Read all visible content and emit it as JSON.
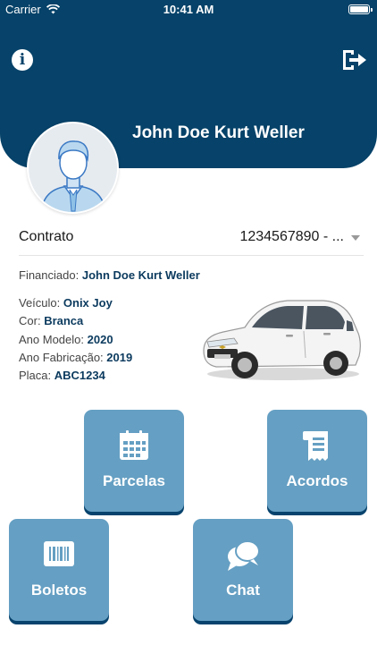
{
  "status_bar": {
    "carrier": "Carrier",
    "time": "10:41 AM"
  },
  "header": {
    "user_name": "John Doe Kurt Weller",
    "color": "#064269"
  },
  "contract": {
    "label": "Contrato",
    "selected": "1234567890 - ..."
  },
  "details": {
    "financiado_label": "Financiado:",
    "financiado_value": "John Doe Kurt Weller",
    "veiculo_label": "Veículo:",
    "veiculo_value": "Onix Joy",
    "cor_label": "Cor:",
    "cor_value": "Branca",
    "ano_modelo_label": "Ano Modelo:",
    "ano_modelo_value": "2020",
    "ano_fabricacao_label": "Ano Fabricação:",
    "ano_fabricacao_value": "2019",
    "placa_label": "Placa:",
    "placa_value": "ABC1234"
  },
  "tiles": {
    "parcelas": "Parcelas",
    "acordos": "Acordos",
    "boletos": "Boletos",
    "chat": "Chat",
    "color": "#659fc3"
  }
}
